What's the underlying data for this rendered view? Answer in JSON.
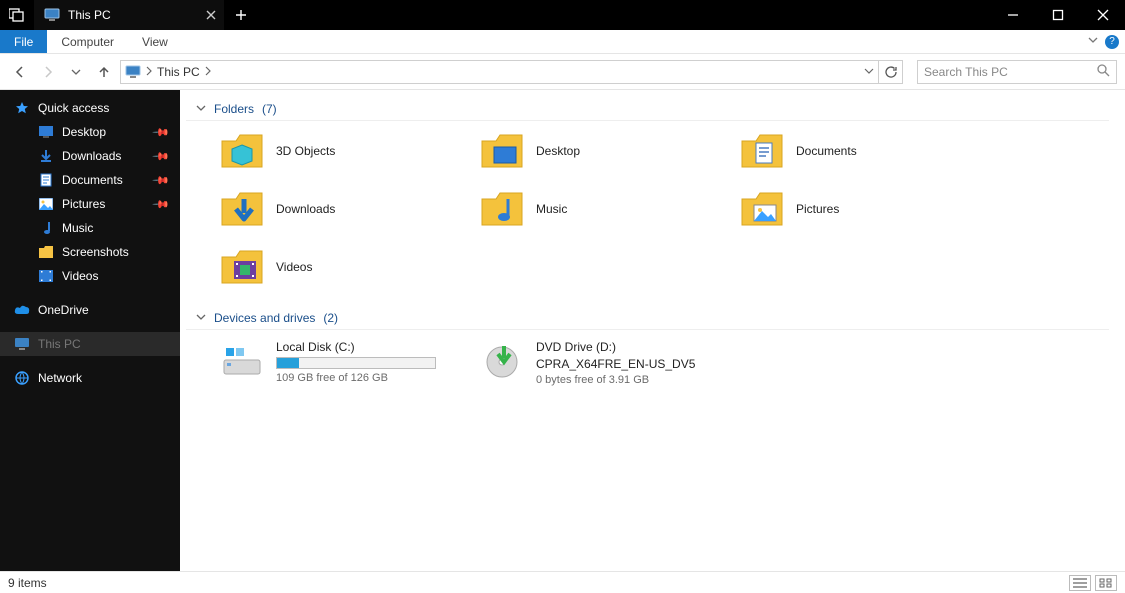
{
  "window": {
    "tab_title": "This PC"
  },
  "ribbon": {
    "file": "File",
    "computer": "Computer",
    "view": "View"
  },
  "address": {
    "crumb": "This PC",
    "search_placeholder": "Search This PC"
  },
  "sidebar": {
    "quick_access": "Quick access",
    "items": [
      {
        "label": "Desktop",
        "pinned": true
      },
      {
        "label": "Downloads",
        "pinned": true
      },
      {
        "label": "Documents",
        "pinned": true
      },
      {
        "label": "Pictures",
        "pinned": true
      },
      {
        "label": "Music",
        "pinned": false
      },
      {
        "label": "Screenshots",
        "pinned": false
      },
      {
        "label": "Videos",
        "pinned": false
      }
    ],
    "onedrive": "OneDrive",
    "this_pc": "This PC",
    "network": "Network"
  },
  "content": {
    "folders_header": "Folders",
    "folders_count": "(7)",
    "folders": [
      {
        "label": "3D Objects"
      },
      {
        "label": "Desktop"
      },
      {
        "label": "Documents"
      },
      {
        "label": "Downloads"
      },
      {
        "label": "Music"
      },
      {
        "label": "Pictures"
      },
      {
        "label": "Videos"
      }
    ],
    "drives_header": "Devices and drives",
    "drives_count": "(2)",
    "drives": [
      {
        "title": "Local Disk (C:)",
        "sub": "109 GB free of 126 GB",
        "fill_pct": 14,
        "kind": "hdd"
      },
      {
        "title": "DVD Drive (D:)",
        "sub2": "CPRA_X64FRE_EN-US_DV5",
        "sub": "0 bytes free of 3.91 GB",
        "kind": "dvd"
      }
    ]
  },
  "status": {
    "text": "9 items"
  }
}
